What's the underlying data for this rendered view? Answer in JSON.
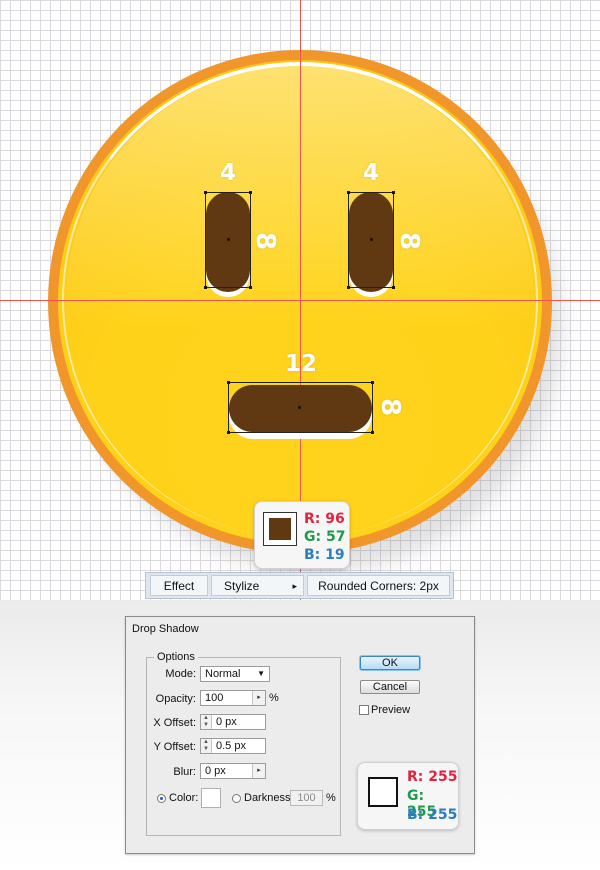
{
  "fill_color": {
    "r_label": "R: 96",
    "g_label": "G: 57",
    "b_label": "B: 19",
    "hex": "#603913"
  },
  "dimensions": {
    "left_eye_width": "4",
    "left_eye_height": "8",
    "right_eye_width": "4",
    "right_eye_height": "8",
    "mouth_width": "12",
    "mouth_height": "8"
  },
  "breadcrumb": {
    "effect": "Effect",
    "stylize": "Stylize",
    "stylize_arrow": "▸",
    "rounded_corners": "Rounded Corners: 2px"
  },
  "dialog": {
    "title": "Drop Shadow",
    "group_label": "Options",
    "mode_label": "Mode:",
    "mode_value": "Normal",
    "opacity_label": "Opacity:",
    "opacity_value": "100",
    "opacity_unit": "%",
    "x_offset_label": "X Offset:",
    "x_offset_value": "0 px",
    "y_offset_label": "Y Offset:",
    "y_offset_value": "0.5 px",
    "blur_label": "Blur:",
    "blur_value": "0 px",
    "color_label": "Color:",
    "darkness_label": "Darkness:",
    "darkness_value": "100",
    "darkness_unit": "%",
    "ok_label": "OK",
    "cancel_label": "Cancel",
    "preview_label": "Preview"
  },
  "shadow_color": {
    "r_label": "R: 255",
    "g_label": "G: 255",
    "b_label": "B: 255",
    "hex": "#ffffff"
  },
  "colors": {
    "red": "#e0243f",
    "green": "#1f9a4d",
    "blue": "#2a7ec1",
    "face": "#ffd21c",
    "outline": "#f0962a"
  }
}
